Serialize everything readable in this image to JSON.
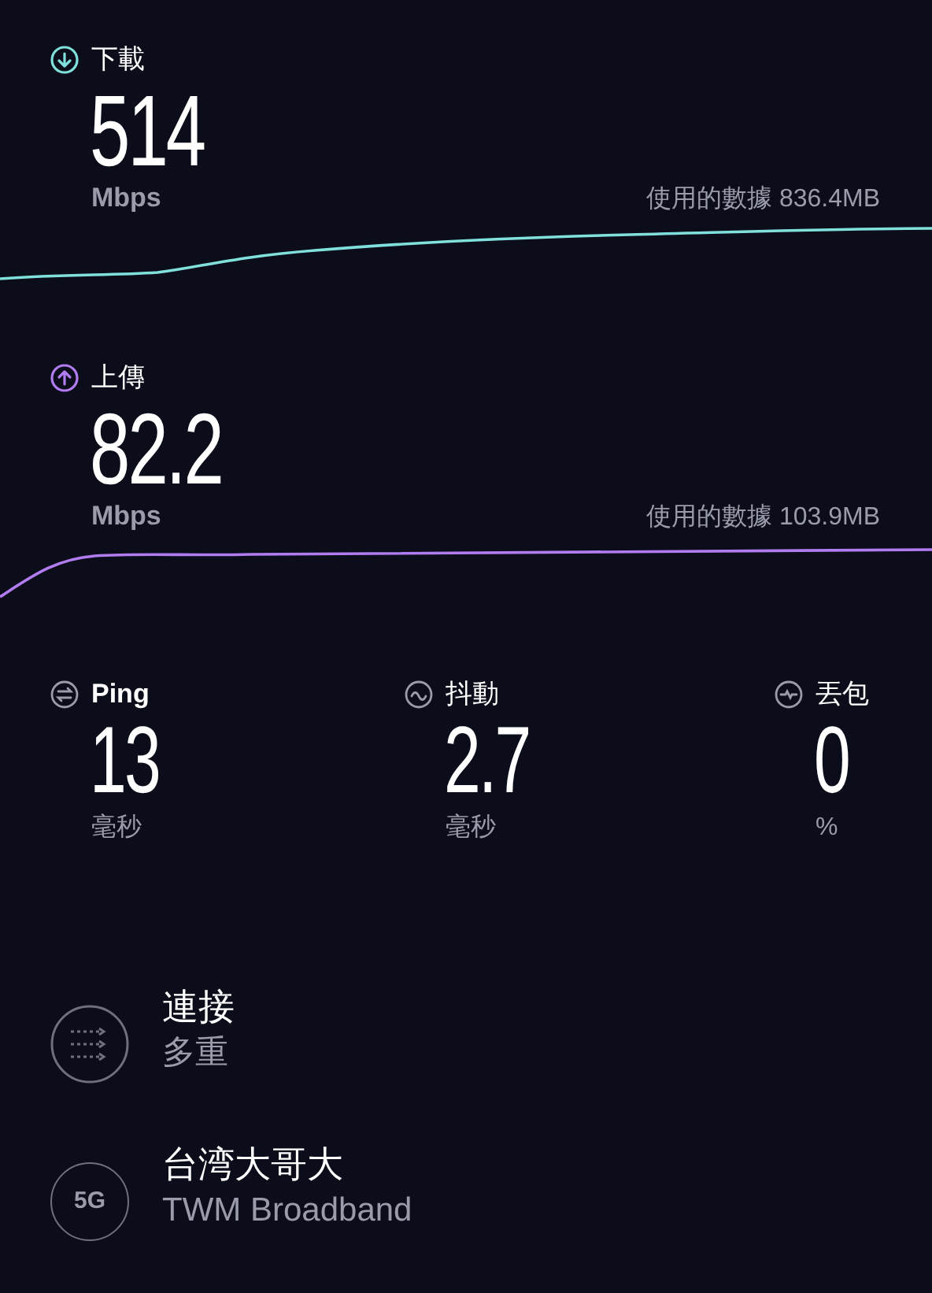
{
  "speeds": [
    {
      "kind": "download",
      "label": "下載",
      "value": "514",
      "unit": "Mbps",
      "data_used": "使用的數據 836.4MB",
      "color": "#7fe0dc"
    },
    {
      "kind": "upload",
      "label": "上傳",
      "value": "82.2",
      "unit": "Mbps",
      "data_used": "使用的數據 103.9MB",
      "color": "#b07cf0"
    }
  ],
  "metrics": [
    {
      "kind": "ping",
      "label": "Ping",
      "value": "13",
      "unit": "毫秒"
    },
    {
      "kind": "jitter",
      "label": "抖動",
      "value": "2.7",
      "unit": "毫秒"
    },
    {
      "kind": "loss",
      "label": "丟包",
      "value": "0",
      "unit": "%"
    }
  ],
  "details": [
    {
      "kind": "connections",
      "title": "連接",
      "subtitle": "多重"
    },
    {
      "kind": "network",
      "badge": "5G",
      "title": "台湾大哥大",
      "subtitle": "TWM Broadband"
    }
  ]
}
